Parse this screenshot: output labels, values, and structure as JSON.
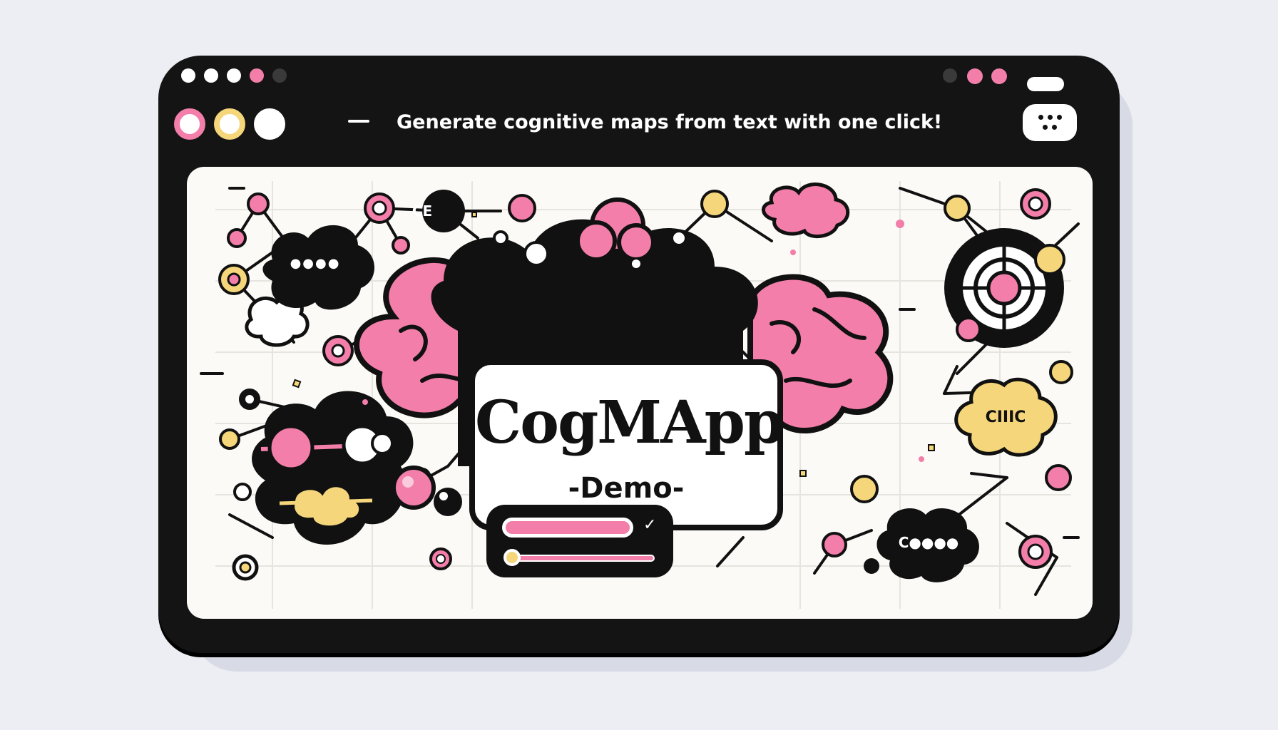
{
  "window": {
    "headline": "Generate cognitive maps from text with one click!"
  },
  "main": {
    "title": "CogMApp",
    "subtitle": "-Demo-"
  },
  "clouds": {
    "top_left_label": "CE",
    "left_cloud_label": "●●●●",
    "right_yellow_label": "CIIIC",
    "bottom_right_label": "C●●●●"
  },
  "controls": {
    "slider_value": 0.05
  },
  "icons": {
    "menu": "more-dots-icon",
    "minimize": "dash-icon",
    "check": "checkmark-icon"
  },
  "colors": {
    "pink": "#f27ea9",
    "yellow": "#f5d67a",
    "black": "#111111",
    "white": "#ffffff",
    "background": "#eceef3"
  }
}
